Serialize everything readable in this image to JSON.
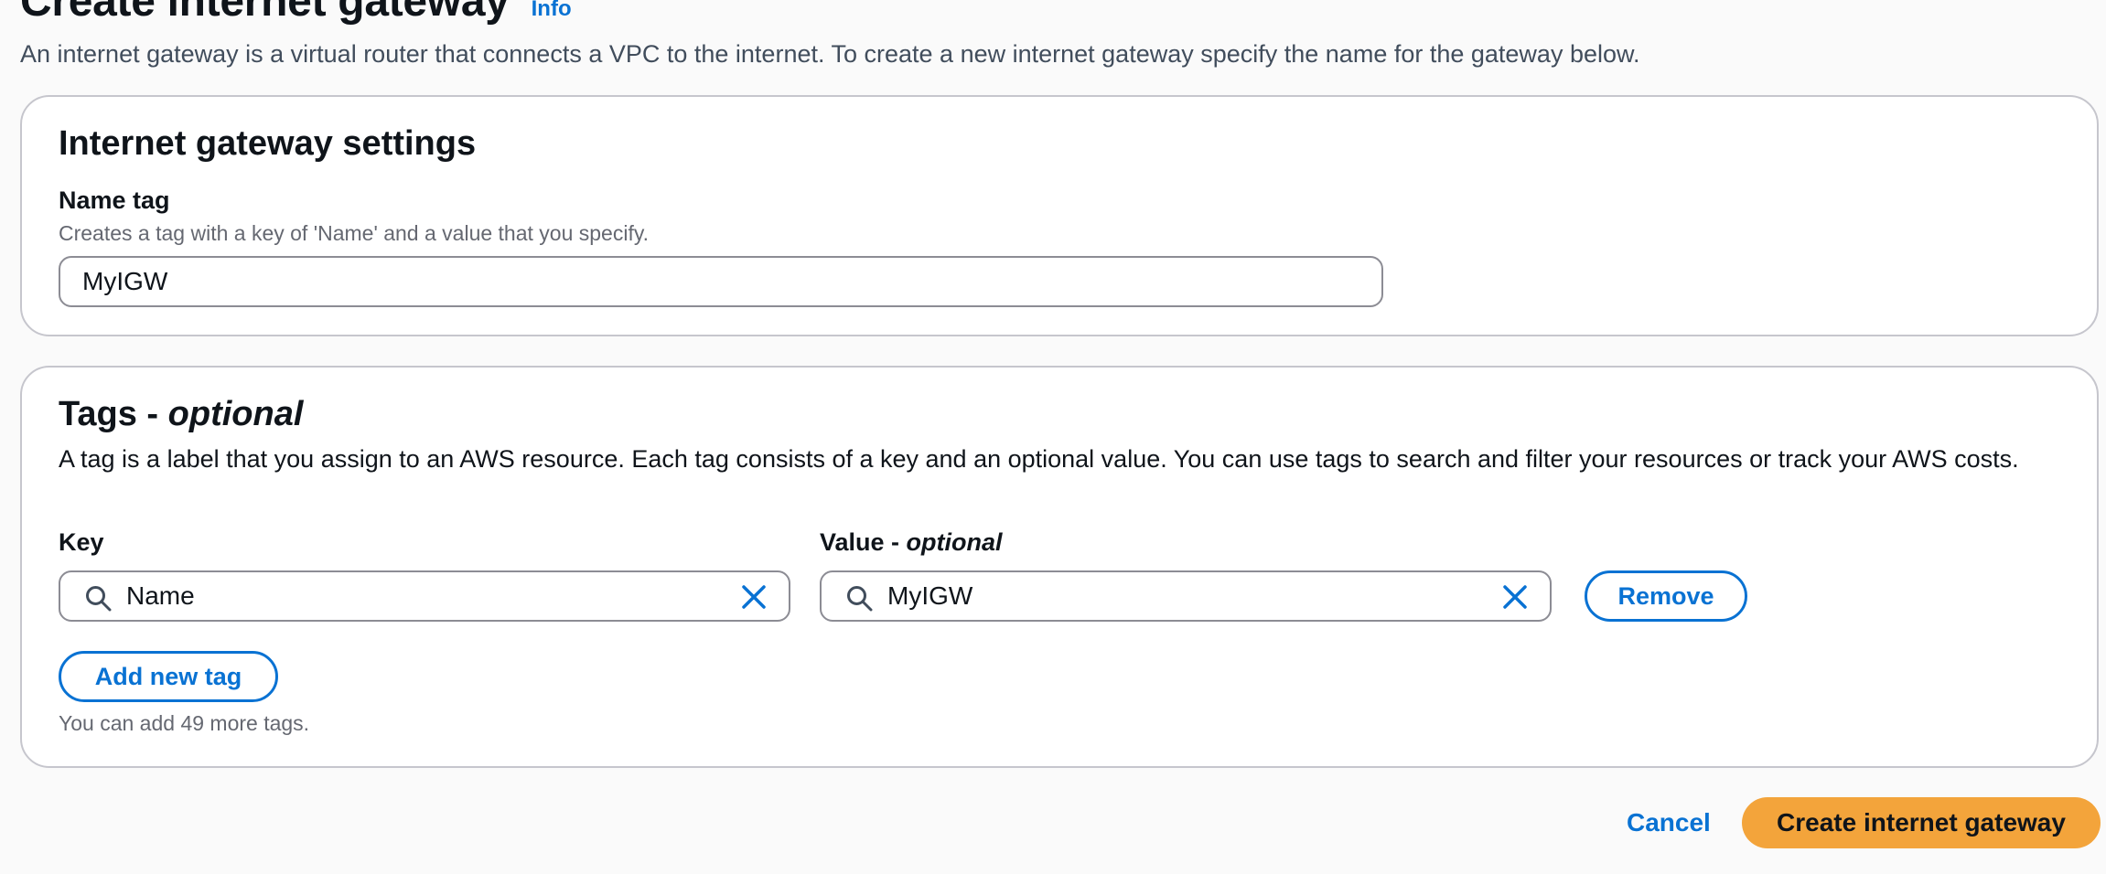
{
  "page": {
    "title": "Create internet gateway",
    "info_link": "Info",
    "description": "An internet gateway is a virtual router that connects a VPC to the internet. To create a new internet gateway specify the name for the gateway below."
  },
  "settings": {
    "heading": "Internet gateway settings",
    "name_tag": {
      "label": "Name tag",
      "description": "Creates a tag with a key of 'Name' and a value that you specify.",
      "value": "MyIGW"
    }
  },
  "tags": {
    "heading": "Tags - ",
    "heading_optional": "optional",
    "description": "A tag is a label that you assign to an AWS resource. Each tag consists of a key and an optional value. You can use tags to search and filter your resources or track your AWS costs.",
    "key_label": "Key",
    "value_label": "Value - ",
    "value_label_optional": "optional",
    "rows": [
      {
        "key": "Name",
        "value": "MyIGW"
      }
    ],
    "remove_label": "Remove",
    "add_label": "Add new tag",
    "limit_text": "You can add 49 more tags."
  },
  "footer": {
    "cancel_label": "Cancel",
    "submit_label": "Create internet gateway"
  },
  "icons": {
    "search": "search-icon",
    "clear": "close-icon"
  },
  "colors": {
    "accent": "#0972d3",
    "primary_button": "#f3a43b",
    "border": "#c6c6cd",
    "background": "#fafafa"
  }
}
